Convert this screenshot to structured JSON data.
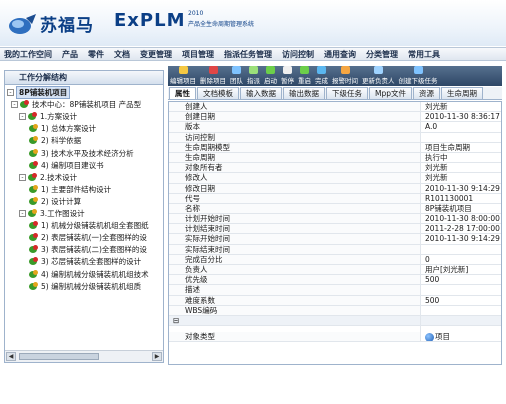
{
  "app": {
    "brand_cn": "苏福马",
    "brand_en": "ExPLM",
    "brand_year": "2010",
    "brand_sub": "产品全生命周期管理系统"
  },
  "menu": [
    "我的工作空间",
    "产品",
    "零件",
    "文档",
    "变更管理",
    "项目管理",
    "指派任务管理",
    "访问控制",
    "通用查询",
    "分类管理",
    "常用工具"
  ],
  "left_panel": {
    "title": "工作分解结构",
    "tree": [
      {
        "label": "8P铺装机项目",
        "level": 0,
        "toggle": "-",
        "icon": "none",
        "selected": true
      },
      {
        "label": "技术中心：8P铺装机项目 产品型",
        "level": 1,
        "toggle": "-",
        "icon": "red"
      },
      {
        "label": "1.方案设计",
        "level": 2,
        "toggle": "-",
        "icon": "red"
      },
      {
        "label": "1) 总体方案设计",
        "level": 3,
        "toggle": "",
        "icon": "gold"
      },
      {
        "label": "2) 科学依据",
        "level": 3,
        "toggle": "",
        "icon": "gold"
      },
      {
        "label": "3) 技术水平及技术经济分析",
        "level": 3,
        "toggle": "",
        "icon": "gold"
      },
      {
        "label": "4) 编制项目建议书",
        "level": 3,
        "toggle": "",
        "icon": "red"
      },
      {
        "label": "2.技术设计",
        "level": 2,
        "toggle": "-",
        "icon": "red"
      },
      {
        "label": "1) 主要部件结构设计",
        "level": 3,
        "toggle": "",
        "icon": "gold"
      },
      {
        "label": "2) 设计计算",
        "level": 3,
        "toggle": "",
        "icon": "gold"
      },
      {
        "label": "3.工作图设计",
        "level": 2,
        "toggle": "-",
        "icon": "gold"
      },
      {
        "label": "1) 机械分级铺装机机组全套图纸",
        "level": 3,
        "toggle": "",
        "icon": "red"
      },
      {
        "label": "2) 表层铺装机(一)全套图样的设",
        "level": 3,
        "toggle": "",
        "icon": "red"
      },
      {
        "label": "3) 表层铺装机(二)全套图样的设",
        "level": 3,
        "toggle": "",
        "icon": "red"
      },
      {
        "label": "3) 芯层铺装机全套图样的设计",
        "level": 3,
        "toggle": "",
        "icon": "red"
      },
      {
        "label": "4) 编制机械分级铺装机机组技术",
        "level": 3,
        "toggle": "",
        "icon": "gold"
      },
      {
        "label": "5) 编制机械分级铺装机机组质",
        "level": 3,
        "toggle": "",
        "icon": "gold"
      }
    ]
  },
  "toolbar": [
    {
      "label": "编辑项目",
      "color": "#f5c842"
    },
    {
      "label": "删除项目",
      "color": "#e04646"
    },
    {
      "label": "团队",
      "color": "#7fc3ff"
    },
    {
      "label": "指派",
      "color": "#9be07a"
    },
    {
      "label": "启动",
      "color": "#6ccf4a"
    },
    {
      "label": "暂停",
      "color": "#f0f0f0"
    },
    {
      "label": "重启",
      "color": "#6ccf4a"
    },
    {
      "label": "完成",
      "color": "#5ab7f0"
    },
    {
      "label": "报警时间",
      "color": "#f5a642"
    },
    {
      "label": "更新负责人",
      "color": "#9fd3ff"
    },
    {
      "label": "创建下级任务",
      "color": "#7fc3ff"
    }
  ],
  "tabs": [
    "属性",
    "文档模板",
    "输入数据",
    "输出数据",
    "下级任务",
    "Mpp文件",
    "资源",
    "生命周期"
  ],
  "active_tab": 0,
  "properties": [
    {
      "k": "创建人",
      "v": "刘光新"
    },
    {
      "k": "创建日期",
      "v": "2010-11-30 8:36:17"
    },
    {
      "k": "版本",
      "v": "A.0"
    },
    {
      "k": "访问控制",
      "v": ""
    },
    {
      "k": "生命周期模型",
      "v": "项目生命周期"
    },
    {
      "k": "生命周期",
      "v": "执行中"
    },
    {
      "k": "对象所有者",
      "v": "刘光新"
    },
    {
      "k": "修改人",
      "v": "刘光新"
    },
    {
      "k": "修改日期",
      "v": "2010-11-30 9:14:29"
    },
    {
      "k": "代号",
      "v": "R101130001"
    },
    {
      "k": "名称",
      "v": "8P铺装机项目"
    },
    {
      "k": "计划开始时间",
      "v": "2010-11-30 8:00:00"
    },
    {
      "k": "计划结束时间",
      "v": "2011-2-28 17:00:00"
    },
    {
      "k": "实际开始时间",
      "v": "2010-11-30 9:14:29"
    },
    {
      "k": "实际结束时间",
      "v": ""
    },
    {
      "k": "完成百分比",
      "v": "0"
    },
    {
      "k": "负责人",
      "v": "用户[刘光新]"
    },
    {
      "k": "优先级",
      "v": "500"
    },
    {
      "k": "描述",
      "v": ""
    },
    {
      "k": "难度系数",
      "v": "500"
    },
    {
      "k": "WBS编码",
      "v": ""
    }
  ],
  "section_toggle": "⊟",
  "object_type": {
    "k": "对象类型",
    "v": "项目"
  }
}
